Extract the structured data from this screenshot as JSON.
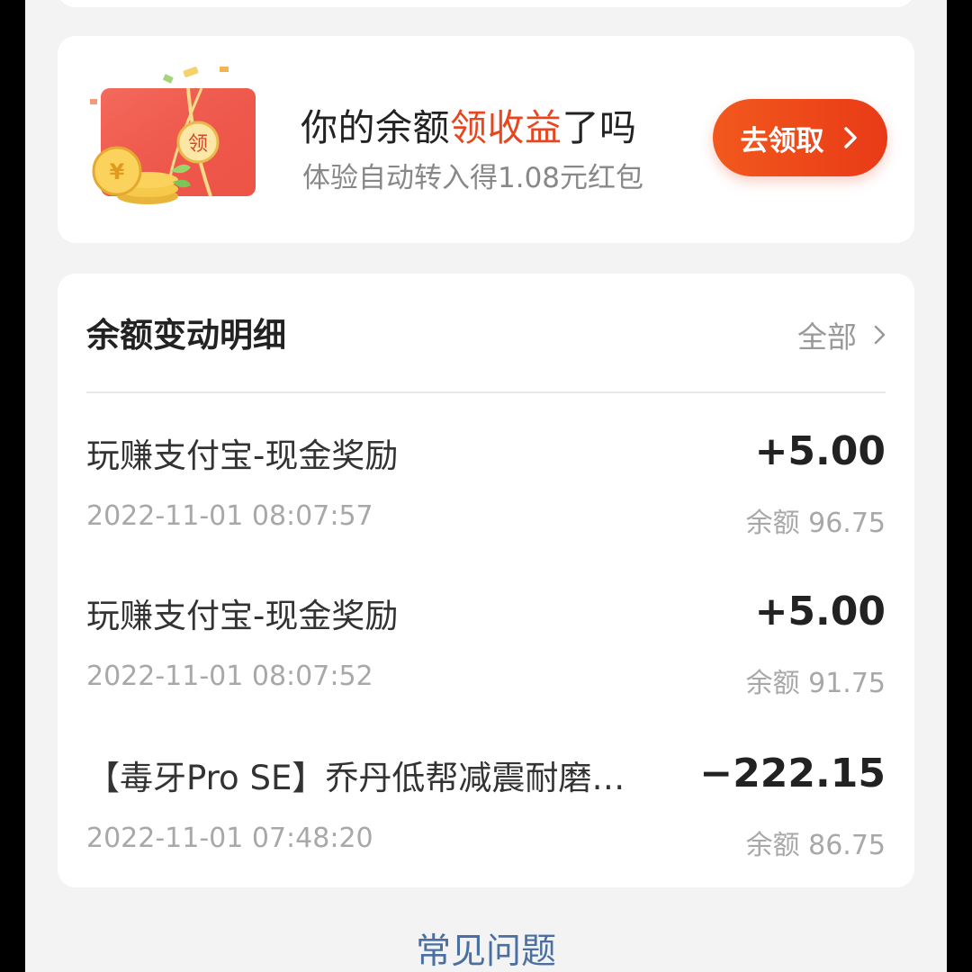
{
  "promo": {
    "title_pre": "你的余额",
    "title_highlight": "领收益",
    "title_post": "了吗",
    "subtitle": "体验自动转入得1.08元红包",
    "button_label": "去领取",
    "illustration_badge": "领",
    "illustration_coin": "¥",
    "accent_color": "#e8461f"
  },
  "detail": {
    "title": "余额变动明细",
    "view_all": "全部",
    "transactions": [
      {
        "title": "玩赚支付宝-现金奖励",
        "amount": "+5.00",
        "time": "2022-11-01 08:07:57",
        "balance": "余额 96.75"
      },
      {
        "title": "玩赚支付宝-现金奖励",
        "amount": "+5.00",
        "time": "2022-11-01 08:07:52",
        "balance": "余额 91.75"
      },
      {
        "title": "【毒牙Pro SE】乔丹低帮减震耐磨…",
        "amount": "−222.15",
        "time": "2022-11-01 07:48:20",
        "balance": "余额 86.75"
      }
    ]
  },
  "faq_link": "常见问题"
}
